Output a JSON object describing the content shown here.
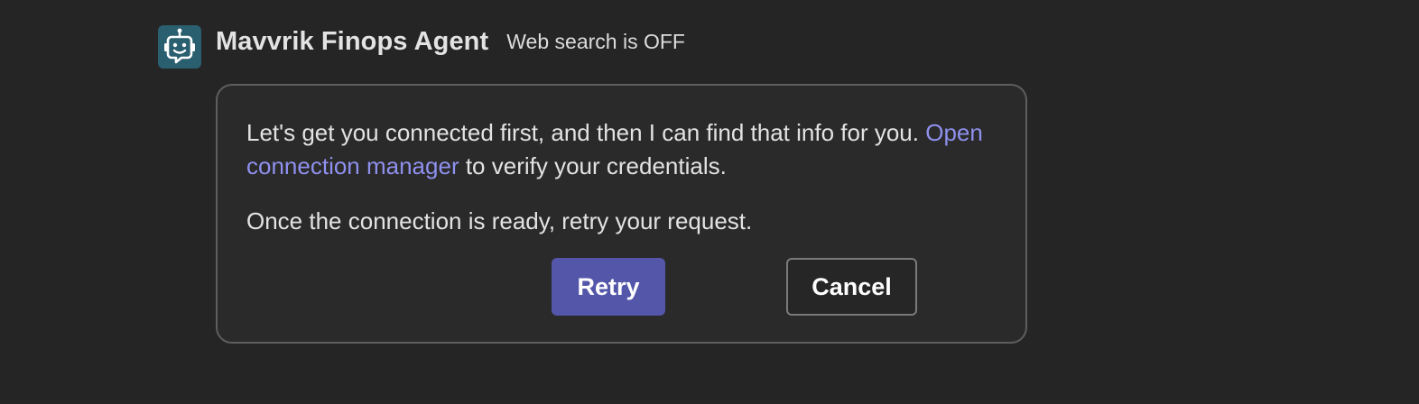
{
  "header": {
    "agent_name": "Mavvrik Finops Agent",
    "web_search_status": "Web search is OFF",
    "avatar_icon": "bot-chat-icon"
  },
  "message": {
    "line1_before_link": "Let's get you connected first, and then I can find that info for you. ",
    "link_text": "Open connection manager",
    "line1_after_link": " to verify your credentials.",
    "line2": "Once the connection is ready, retry your request."
  },
  "actions": {
    "retry_label": "Retry",
    "cancel_label": "Cancel"
  },
  "colors": {
    "background": "#252525",
    "card_background": "#2a2a2a",
    "card_border": "#5e5e5e",
    "link": "#8f90ee",
    "primary_button": "#5356a9",
    "avatar_background": "#2a5f70"
  }
}
